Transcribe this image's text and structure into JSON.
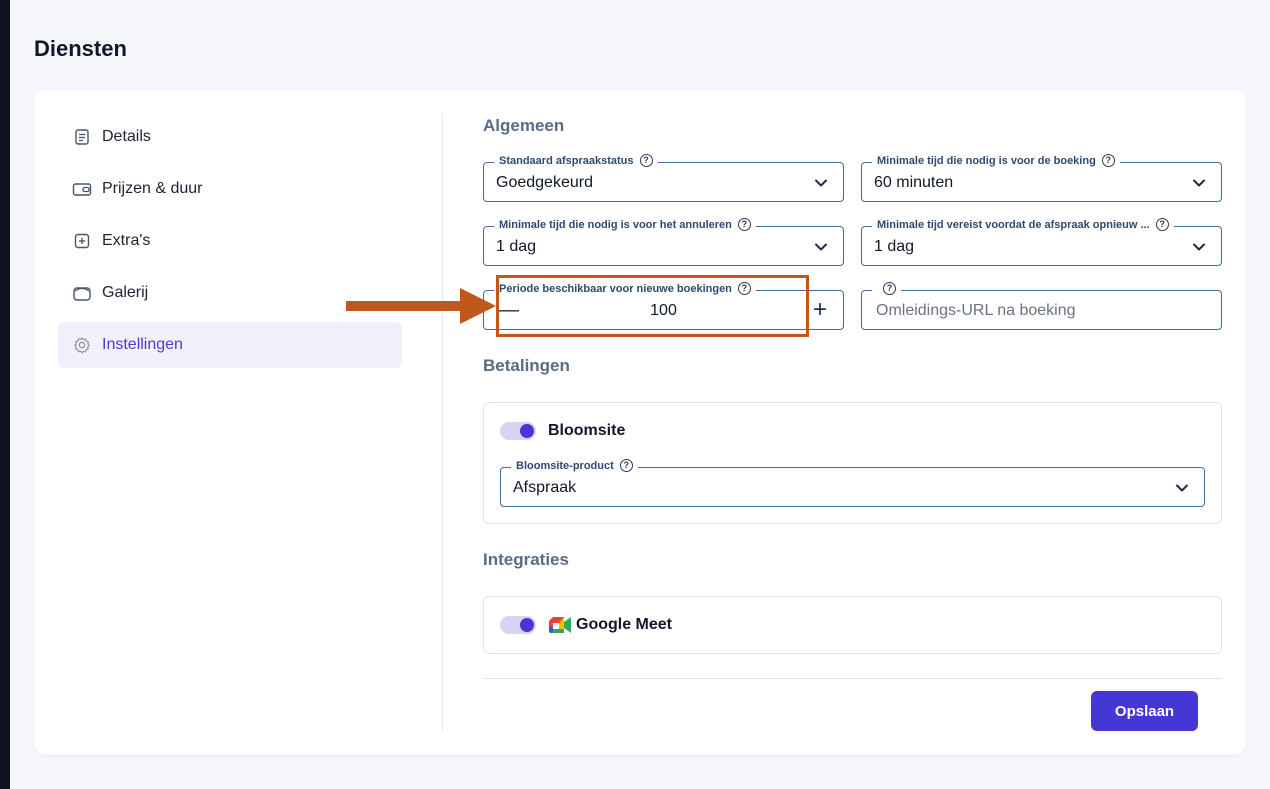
{
  "page": {
    "title": "Diensten"
  },
  "nav": {
    "items": [
      {
        "label": "Details",
        "icon": "document-icon",
        "active": false
      },
      {
        "label": "Prijzen & duur",
        "icon": "wallet-icon",
        "active": false
      },
      {
        "label": "Extra's",
        "icon": "plus-square-icon",
        "active": false
      },
      {
        "label": "Galerij",
        "icon": "gallery-icon",
        "active": false
      },
      {
        "label": "Instellingen",
        "icon": "gear-icon",
        "active": true
      }
    ]
  },
  "general": {
    "title": "Algemeen",
    "default_status": {
      "label": "Standaard afspraakstatus",
      "value": "Goedgekeurd"
    },
    "min_time_booking": {
      "label": "Minimale tijd die nodig is voor de boeking",
      "value": "60 minuten"
    },
    "min_time_cancel": {
      "label": "Minimale tijd die nodig is voor het annuleren",
      "value": "1 dag"
    },
    "min_time_reschedule": {
      "label": "Minimale tijd vereist voordat de afspraak opnieuw ...",
      "value": "1 dag"
    },
    "period_available": {
      "label": "Periode beschikbaar voor nieuwe boekingen",
      "value": "100",
      "minus": "—",
      "plus": "+"
    },
    "redirect_url": {
      "label": "",
      "placeholder": "Omleidings-URL na boeking"
    }
  },
  "payments": {
    "title": "Betalingen",
    "provider": {
      "label": "Bloomsite",
      "enabled": true
    },
    "product": {
      "label": "Bloomsite-product",
      "value": "Afspraak"
    }
  },
  "integrations": {
    "title": "Integraties",
    "google_meet": {
      "label": "Google Meet",
      "enabled": true
    }
  },
  "actions": {
    "save_label": "Opslaan"
  },
  "colors": {
    "accent": "#4636d6",
    "highlight": "#c0571d",
    "field_border": "#4a6a96"
  }
}
